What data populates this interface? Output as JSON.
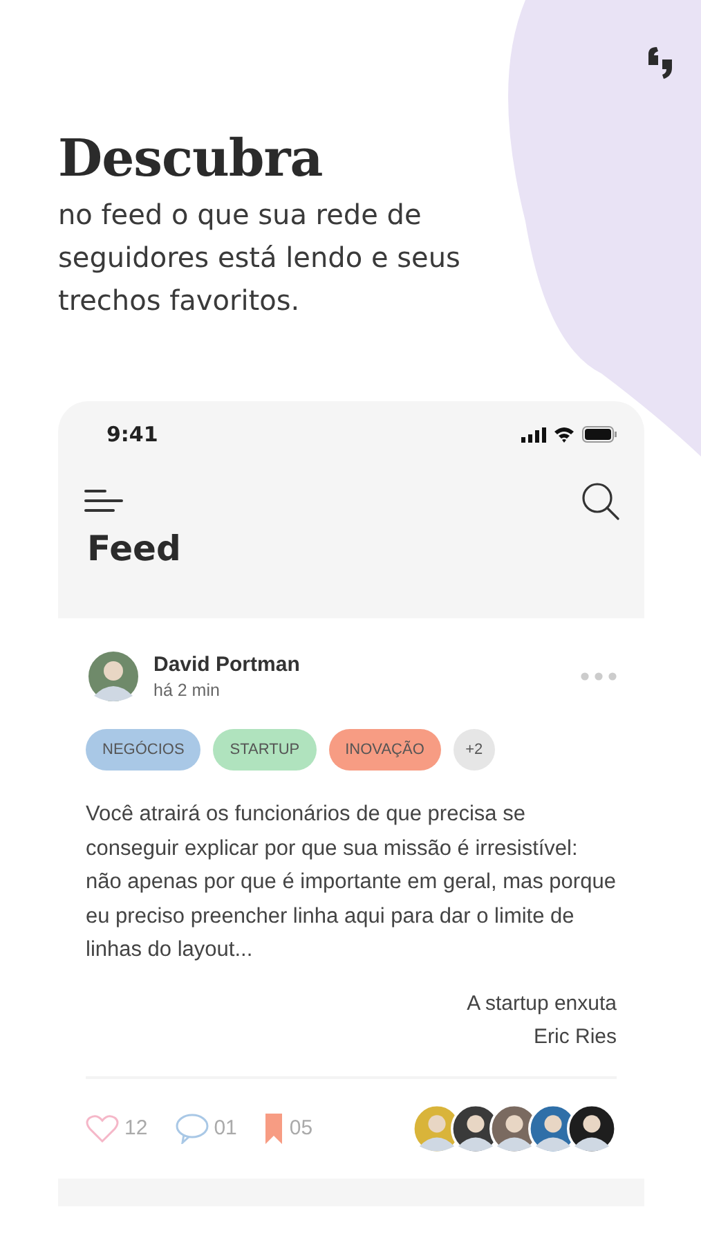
{
  "intro": {
    "title": "Descubra",
    "subtitle": "no feed o que sua rede de seguidores está lendo e seus trechos favoritos."
  },
  "status_bar": {
    "time": "9:41"
  },
  "screen": {
    "title": "Feed"
  },
  "post": {
    "author": "David Portman",
    "time": "há 2 min",
    "author_avatar": {
      "kind": "avatar",
      "color": "#6f8a6a"
    },
    "tags": [
      {
        "label": "NEGÓCIOS",
        "color": "#a9c8e6"
      },
      {
        "label": "STARTUP",
        "color": "#b0e3be"
      },
      {
        "label": "INOVAÇÃO",
        "color": "#f79c83"
      },
      {
        "label": "+2",
        "color": "#e6e6e6"
      }
    ],
    "text": "Você atrairá os funcionários de que precisa se conseguir explicar por que sua missão é irresistível: não apenas por que é importante em geral, mas porque eu preciso preencher linha aqui para dar o limite de linhas do layout...",
    "book_title": "A startup enxuta",
    "book_author": "Eric Ries",
    "likes": "12",
    "comments": "01",
    "saves": "05",
    "readers": [
      {
        "kind": "avatar",
        "color": "#d9b43a"
      },
      {
        "kind": "avatar",
        "color": "#3a3a3a"
      },
      {
        "kind": "avatar",
        "color": "#7a6a60"
      },
      {
        "kind": "avatar",
        "color": "#2f6fa8"
      },
      {
        "kind": "avatar",
        "color": "#1e1e1e"
      }
    ]
  }
}
